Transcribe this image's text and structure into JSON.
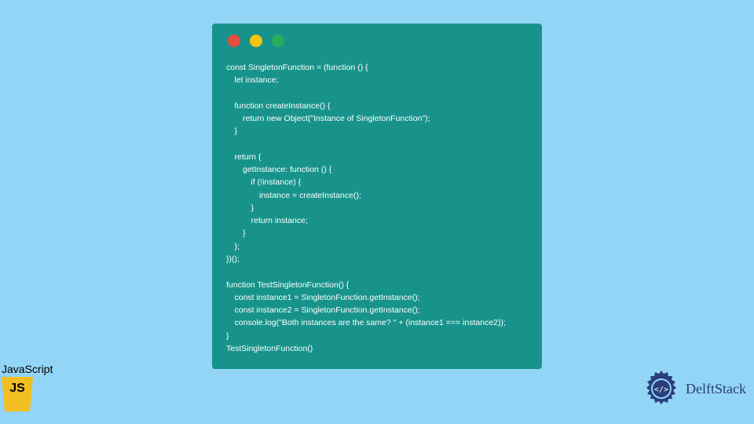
{
  "code": "const SingletonFunction = (function () {\n　let instance;\n\n　function createInstance() {\n　　return new Object(\"Instance of SingletonFunction\");\n　}\n\n　return {\n　　getInstance: function () {\n　　　if (!instance) {\n　　　　instance = createInstance();\n　　　}\n　　　return instance;\n　　}\n　};\n})();\n\nfunction TestSingletonFunction() {\n　const instance1 = SingletonFunction.getInstance();\n　const instance2 = SingletonFunction.getInstance();\n　console.log(\"Both instances are the same? \" + (instance1 === instance2));\n}\nTestSingletonFunction()",
  "js_label": "JavaScript",
  "delft_label": "DelftStack",
  "colors": {
    "bg": "#93d5f6",
    "window": "#17938b",
    "red": "#e84d3d",
    "yellow": "#f2c40e",
    "green": "#26ad5e",
    "js_yellow": "#f2bf22",
    "delft_blue": "#2a3d7c"
  }
}
